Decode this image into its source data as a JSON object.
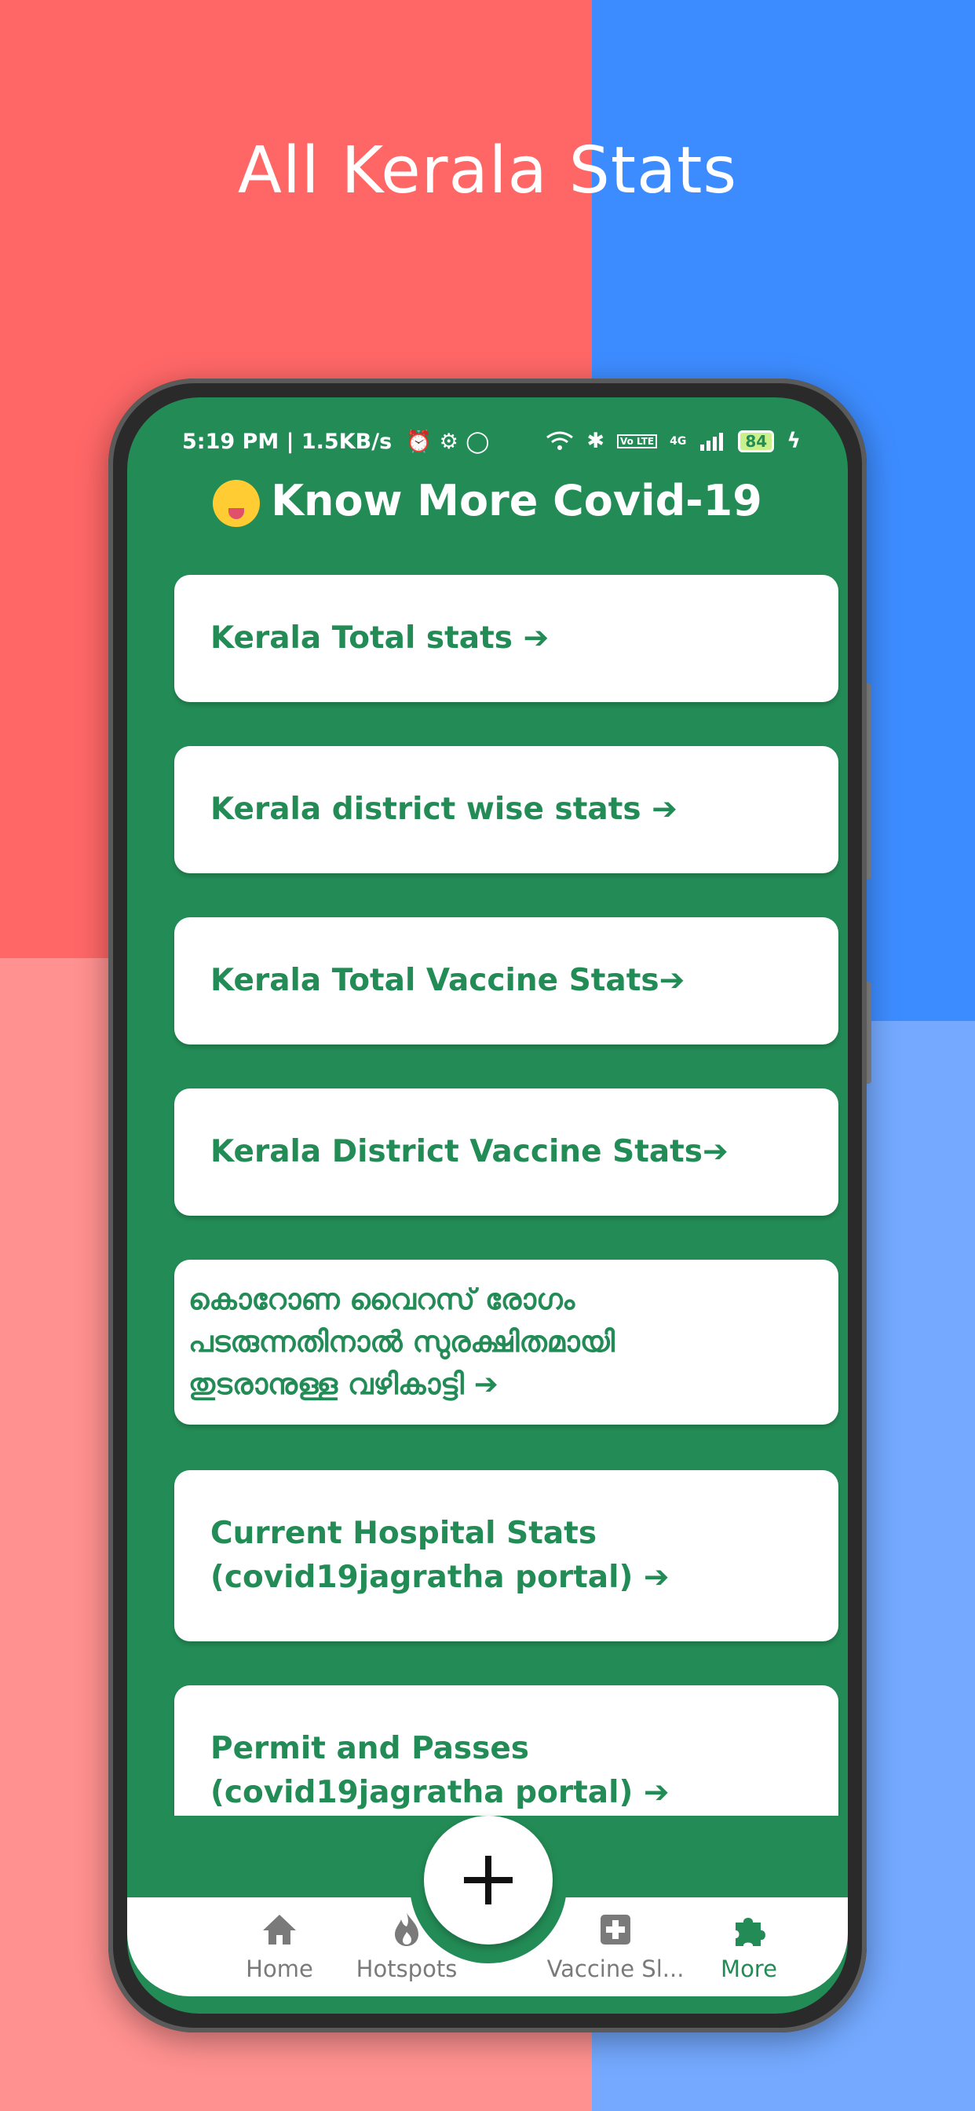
{
  "promo": {
    "title": "All Kerala Stats"
  },
  "status_bar": {
    "time_speed": "5:19 PM | 1.5KB/s",
    "network": "4G",
    "volte": "Vo LTE",
    "battery": "84"
  },
  "app": {
    "title": "Know More Covid-19"
  },
  "cards": [
    {
      "label": "Kerala Total stats ➔"
    },
    {
      "label": "Kerala district wise stats ➔"
    },
    {
      "label": "Kerala Total Vaccine Stats➔"
    },
    {
      "label": "Kerala District Vaccine Stats➔"
    },
    {
      "line1": "കൊറോണ വൈറസ് രോഗം",
      "line2": "പടരുന്നതിനാൽ സുരക്ഷിതമായി",
      "line3": "തുടരാനുള്ള വഴികാട്ടി ➔"
    },
    {
      "line1": "Current Hospital Stats",
      "line2": "(covid19jagratha portal) ➔"
    },
    {
      "line1": "Permit and Passes",
      "line2": "(covid19jagratha portal) ➔"
    }
  ],
  "nav": {
    "home": "Home",
    "hotspots": "Hotspots",
    "vaccine": "Vaccine Sl...",
    "more": "More"
  },
  "colors": {
    "primary": "#238c56",
    "inactive": "#7a7a7a"
  }
}
